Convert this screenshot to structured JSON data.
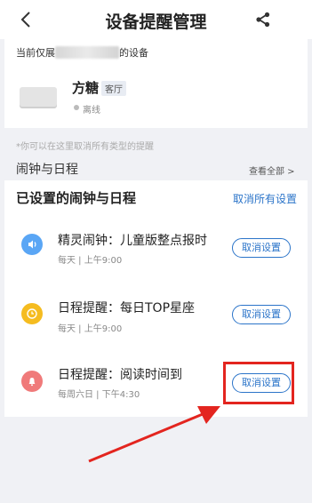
{
  "header": {
    "title": "设备提醒管理",
    "back_icon": "back-chevron-icon",
    "share_icon": "share-icon"
  },
  "device": {
    "scope_prefix": "当前仅展",
    "scope_suffix": "的设备",
    "name": "方糖",
    "room": "客厅",
    "status": "离线"
  },
  "hint": "*你可以在这里取消所有类型的提醒",
  "section": {
    "title": "闹钟与日程",
    "view_all": "查看全部 >"
  },
  "schedules": {
    "header": "已设置的闹钟与日程",
    "cancel_all": "取消所有设置",
    "items": [
      {
        "title": "精灵闹钟：儿童版整点报时",
        "sub": "每天 | 上午9:00",
        "button": "取消设置",
        "icon": "speaker-icon",
        "color": "#5aa6f5"
      },
      {
        "title": "日程提醒：每日TOP星座",
        "sub": "每天 | 上午9:00",
        "button": "取消设置",
        "icon": "clock-icon",
        "color": "#f5bc20"
      },
      {
        "title": "日程提醒：阅读时间到",
        "sub": "每周六日 | 下午4:30",
        "button": "取消设置",
        "icon": "bell-icon",
        "color": "#f07a7a"
      }
    ]
  },
  "annotation_color": "#e3251f"
}
